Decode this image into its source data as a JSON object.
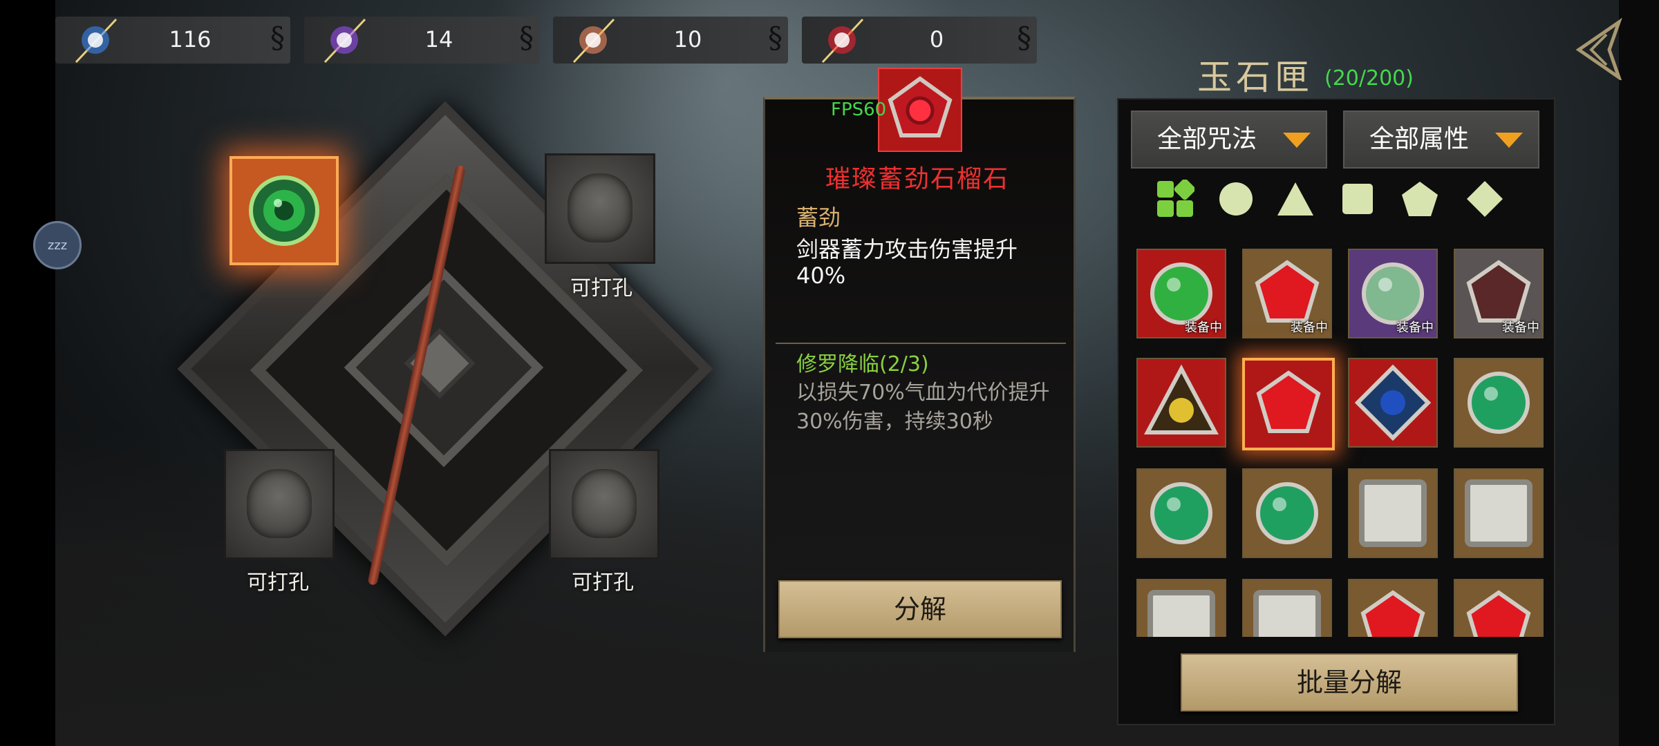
{
  "currencies": [
    {
      "name": "blue-crystal",
      "value": "116",
      "color": "#3a8cff"
    },
    {
      "name": "purple-crystal",
      "value": "14",
      "color": "#a050ff"
    },
    {
      "name": "orange-crystal",
      "value": "10",
      "color": "#ff9060"
    },
    {
      "name": "red-crystal",
      "value": "0",
      "color": "#ff2030"
    }
  ],
  "sleep_badge": "zzz",
  "sockets": {
    "slot_label": "可打孔",
    "labels": [
      "可打孔",
      "可打孔",
      "可打孔"
    ]
  },
  "detail": {
    "fps": "FPS60",
    "gem_name": "璀璨蓄劲石榴石",
    "attr_title": "蓄劲",
    "attr_desc": "剑器蓄力攻击伤害提升40%",
    "set_name": "修罗降临(2/3)",
    "set_desc": "以损失70%气血为代价提升30%伤害，持续30秒",
    "decompose_label": "分解"
  },
  "inventory": {
    "title": "玉石匣",
    "count": "(20/200)",
    "filter_spell": "全部咒法",
    "filter_attr": "全部属性",
    "equipped_tag": "装备中",
    "batch_label": "批量分解",
    "shapes": [
      "all-shapes-icon",
      "circle-icon",
      "triangle-icon",
      "square-icon",
      "pentagon-icon",
      "diamond-icon"
    ],
    "items": [
      {
        "shape": "circle",
        "gem": "#30b040",
        "bg": "#b01818",
        "equipped": true
      },
      {
        "shape": "pentagon",
        "gem": "#e01820",
        "bg": "#7a5a30",
        "equipped": true
      },
      {
        "shape": "circle",
        "gem": "#80b890",
        "bg": "#5a3a7a",
        "equipped": true
      },
      {
        "shape": "pentagon",
        "gem": "#5a2828",
        "bg": "#5a5454",
        "equipped": true
      },
      {
        "shape": "triangle",
        "gem": "#e0c030",
        "bg": "#b01818",
        "equipped": false
      },
      {
        "shape": "pentagon",
        "gem": "#e01820",
        "bg": "#b01818",
        "equipped": false,
        "selected": true
      },
      {
        "shape": "diamond",
        "gem": "#2050c0",
        "bg": "#b01818",
        "equipped": false
      },
      {
        "shape": "circle",
        "gem": "#20a060",
        "bg": "#7a5a30",
        "equipped": false
      },
      {
        "shape": "circle",
        "gem": "#20a060",
        "bg": "#7a5a30",
        "equipped": false
      },
      {
        "shape": "circle",
        "gem": "#20a060",
        "bg": "#7a5a30",
        "equipped": false
      },
      {
        "shape": "square",
        "gem": "#d8d8d0",
        "bg": "#7a5a30",
        "equipped": false
      },
      {
        "shape": "square",
        "gem": "#d8d8d0",
        "bg": "#7a5a30",
        "equipped": false
      },
      {
        "shape": "square",
        "gem": "#d8d8d0",
        "bg": "#7a5a30",
        "equipped": false
      },
      {
        "shape": "square",
        "gem": "#d8d8d0",
        "bg": "#7a5a30",
        "equipped": false
      },
      {
        "shape": "pentagon",
        "gem": "#e01820",
        "bg": "#7a5a30",
        "equipped": false
      },
      {
        "shape": "pentagon",
        "gem": "#e01820",
        "bg": "#7a5a30",
        "equipped": false
      }
    ]
  }
}
